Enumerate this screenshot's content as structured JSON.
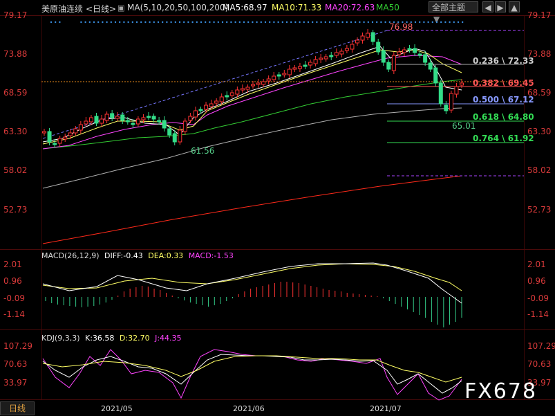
{
  "header": {
    "instrument": "美原油连续",
    "period": "<日线>",
    "ma_params": "MA(5,10,20,50,100,200)",
    "ma5": "MA5:68.97",
    "ma10": "MA10:71.33",
    "ma20": "MA20:72.63",
    "ma50": "MA50",
    "theme_btn": "全部主题",
    "colors": {
      "ma5": "#ffffff",
      "ma10": "#ffff66",
      "ma20": "#ff44ff",
      "ma50": "#33cc33",
      "up": "#ff3333",
      "down": "#33cc77"
    }
  },
  "price_axis": {
    "left": [
      "79.17",
      "73.88",
      "68.59",
      "63.30",
      "58.02",
      "52.73"
    ],
    "right": [
      "79.17",
      "73.88",
      "68.59",
      "63.30",
      "58.02",
      "52.73"
    ]
  },
  "annotations": {
    "high": "76.98",
    "low1": "61.56",
    "low2": "65.01"
  },
  "fibonacci": [
    {
      "label": "0.236 \\ 72.33",
      "color": "#cccccc"
    },
    {
      "label": "0.382 \\ 69.45",
      "color": "#ff5555"
    },
    {
      "label": "0.500 \\ 67.12",
      "color": "#8899ff"
    },
    {
      "label": "0.618 \\ 64.80",
      "color": "#33dd55"
    },
    {
      "label": "0.764 \\ 61.92",
      "color": "#33dd55"
    }
  ],
  "macd": {
    "title": "MACD(26,12,9)",
    "diff": "DIFF:-0.43",
    "dea": "DEA:0.33",
    "macd": "MACD:-1.53",
    "axis": [
      "2.01",
      "0.96",
      "-0.09",
      "-1.14"
    ]
  },
  "kdj": {
    "title": "KDJ(9,3,3)",
    "k": "K:36.58",
    "d": "D:32.70",
    "j": "J:44.35",
    "axis": [
      "107.29",
      "70.63",
      "33.97"
    ]
  },
  "x_axis": [
    "2021/05",
    "2021/06",
    "2021/07"
  ],
  "bottom_tab": "日线",
  "watermark": "FX678",
  "chart_data": {
    "type": "candlestick",
    "title": "美原油连续 <日线>",
    "ylim": [
      50.5,
      80.5
    ],
    "x": [
      "2021/05",
      "2021/06",
      "2021/07"
    ],
    "series": [
      {
        "name": "MA5",
        "values": [
          68.97
        ]
      },
      {
        "name": "MA10",
        "values": [
          71.33
        ]
      },
      {
        "name": "MA20",
        "values": [
          72.63
        ]
      }
    ],
    "highlights": {
      "high": 76.98,
      "low_may": 61.56,
      "low_jul": 65.01
    },
    "fibonacci_levels": [
      72.33,
      69.45,
      67.12,
      64.8,
      61.92
    ],
    "macd": {
      "diff": -0.43,
      "dea": 0.33,
      "macd": -1.53
    },
    "kdj": {
      "k": 36.58,
      "d": 32.7,
      "j": 44.35
    }
  }
}
